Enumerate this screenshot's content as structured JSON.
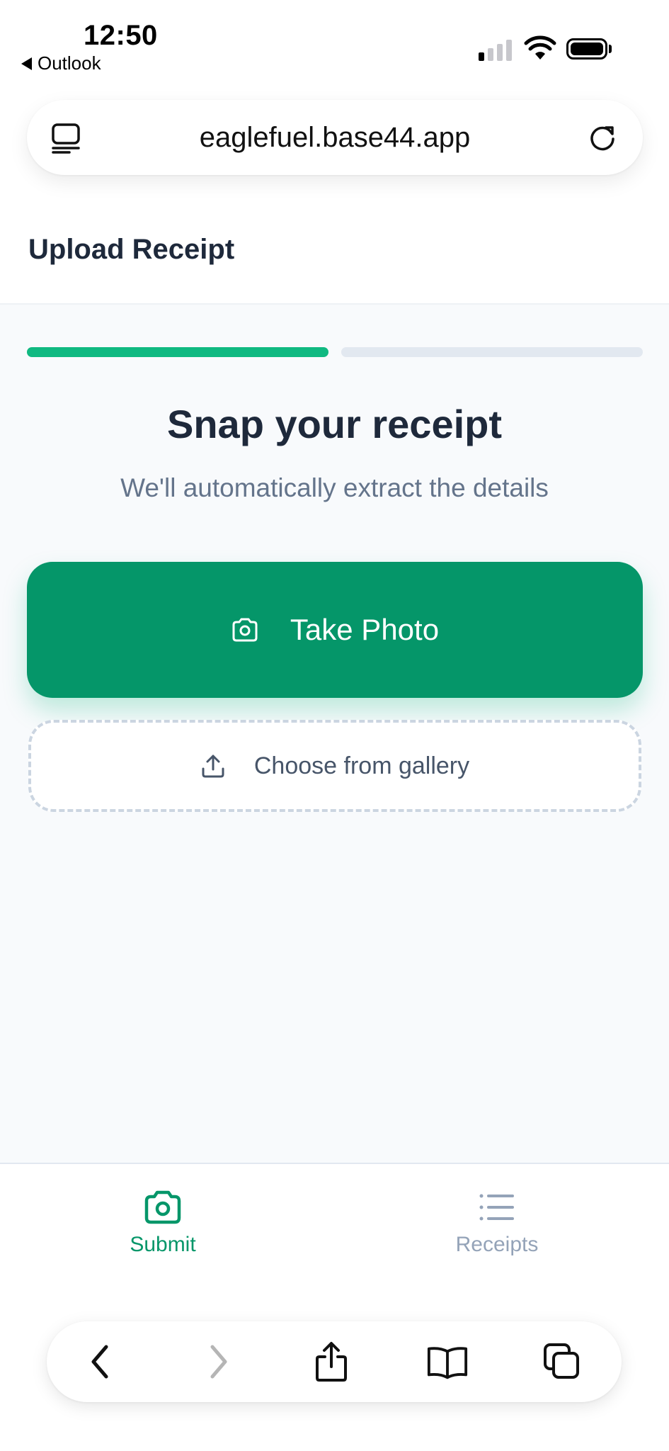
{
  "status_bar": {
    "time": "12:50",
    "back_app": "Outlook"
  },
  "browser": {
    "url": "eaglefuel.base44.app",
    "tab_icon": "tabs-icon",
    "reload_icon": "reload-icon"
  },
  "page": {
    "title": "Upload Receipt"
  },
  "progress": {
    "current_step": 1,
    "total_steps": 2,
    "active_color": "#10b981",
    "inactive_color": "#e2e8f0"
  },
  "hero": {
    "title": "Snap your receipt",
    "subtitle": "We'll automatically extract the details"
  },
  "actions": {
    "take_photo_label": "Take Photo",
    "take_photo_icon": "camera-icon",
    "gallery_label": "Choose from gallery",
    "gallery_icon": "upload-icon"
  },
  "bottom_nav": {
    "items": [
      {
        "label": "Submit",
        "icon": "camera-icon",
        "active": true
      },
      {
        "label": "Receipts",
        "icon": "list-icon",
        "active": false
      }
    ]
  },
  "safari_toolbar": {
    "buttons": [
      "back-icon",
      "forward-icon",
      "share-icon",
      "bookmarks-icon",
      "tabs-overview-icon"
    ]
  },
  "colors": {
    "accent": "#059669",
    "accent_light": "#10b981",
    "text_dark": "#1e293b",
    "text_muted": "#64748b"
  }
}
